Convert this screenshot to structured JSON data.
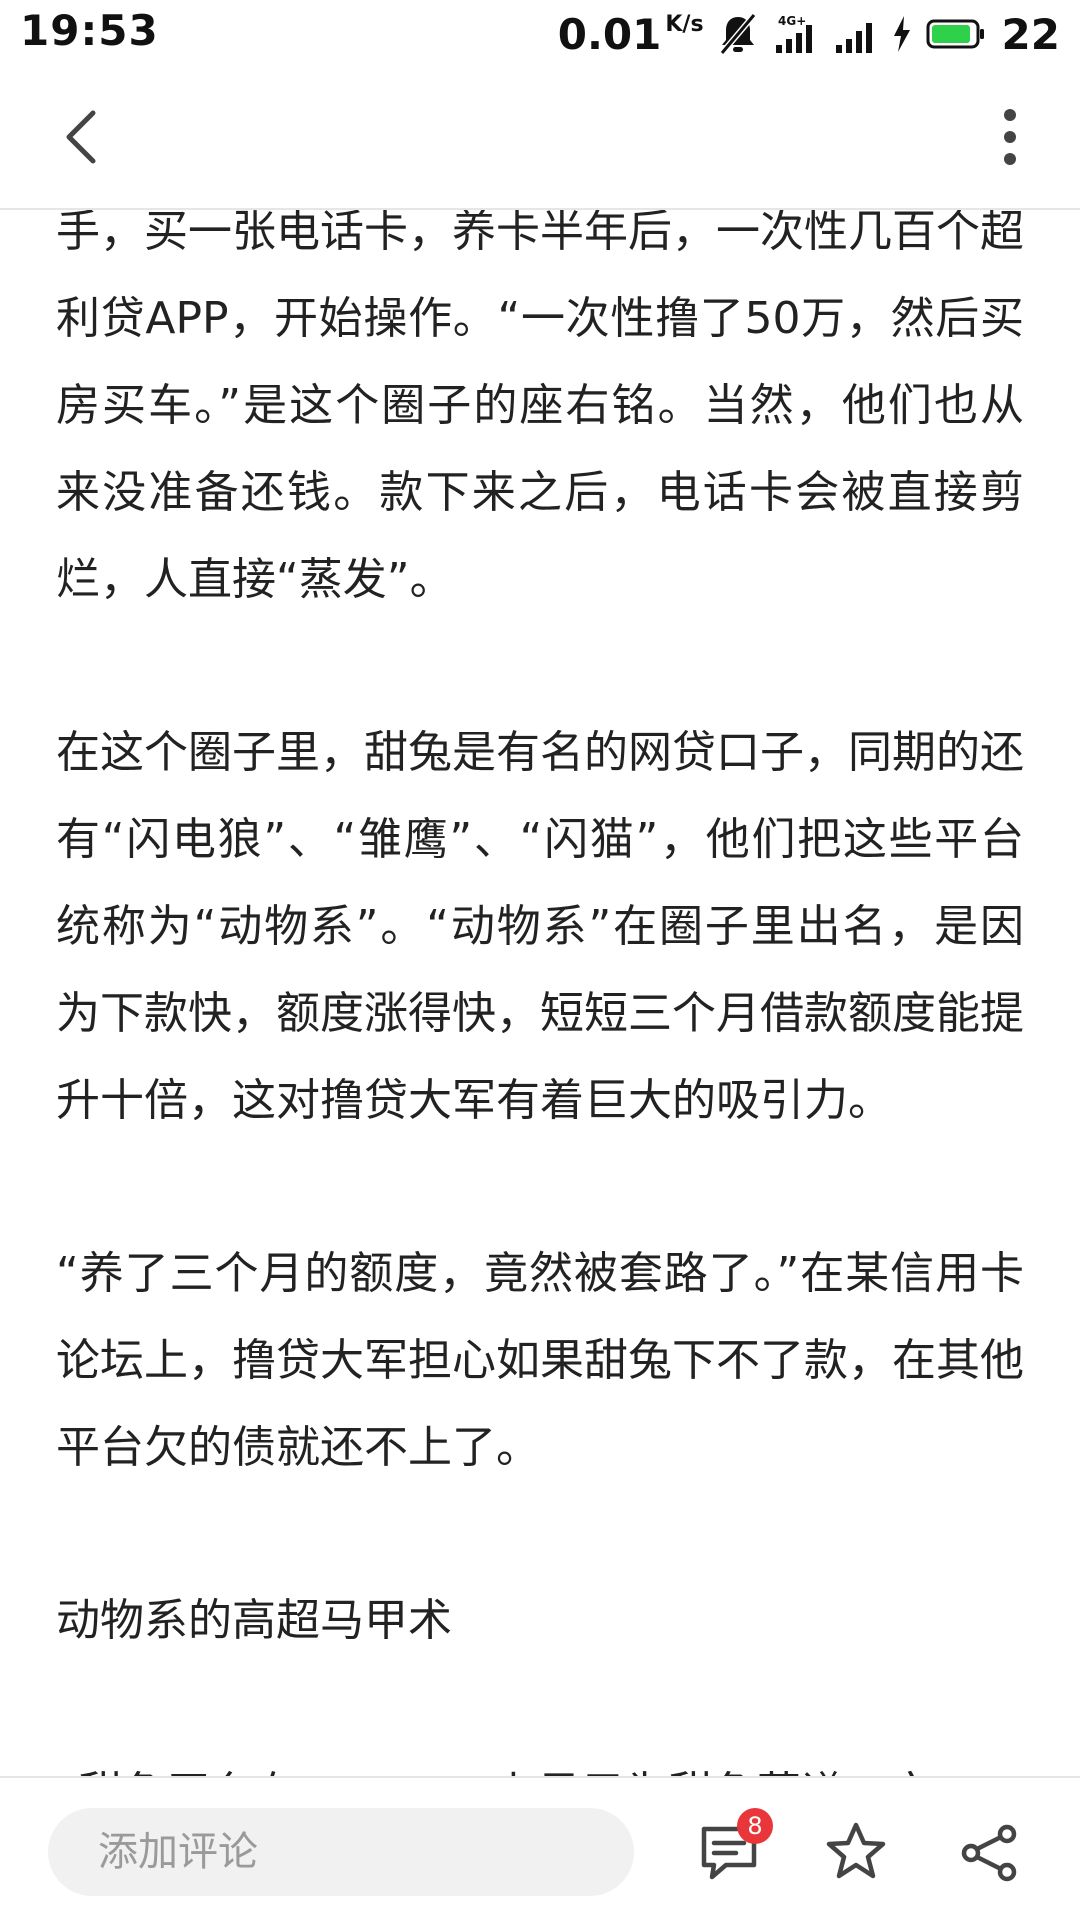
{
  "status_bar": {
    "time": "19:53",
    "net_speed": "0.01",
    "net_speed_unit": "K/s",
    "network_type": "4G+",
    "battery_level": "22",
    "battery_color": "#2fd04a",
    "icons": [
      "mute-bell-icon",
      "signal-4g-icon",
      "signal-icon",
      "charging-icon",
      "battery-icon"
    ]
  },
  "nav": {
    "back_icon": "chevron-left-icon",
    "more_icon": "more-vertical-icon"
  },
  "article": {
    "paragraphs": [
      "手，买一张电话卡，养卡半年后，一次性几百个超利贷APP，开始操作。“一次性撸了50万，然后买房买车。”是这个圈子的座右铭。当然，他们也从来没准备还钱。款下来之后，电话卡会被直接剪烂，人直接“蒸发”。",
      "在这个圈子里，甜兔是有名的网贷口子，同期的还有“闪电狼”、“雏鹰”、“闪猫”，他们把这些平台统称为“动物系”。“动物系”在圈子里出名，是因为下款快，额度涨得快，短短三个月借款额度能提升十倍，这对撸贷大军有着巨大的吸引力。",
      "“养了三个月的额度，竟然被套路了。”在某信用卡论坛上，撸贷大军担心如果甜兔下不了款，在其他平台欠的债就还不上了。",
      "动物系的高超马甲术",
      "“甜兔平台在appstore上显示为甜兔菜谱，实"
    ]
  },
  "bottom_bar": {
    "comment_placeholder": "添加评论",
    "comment_count": "8",
    "badge_color": "#e8363a",
    "icons": [
      "comment-icon",
      "star-icon",
      "share-icon"
    ]
  }
}
